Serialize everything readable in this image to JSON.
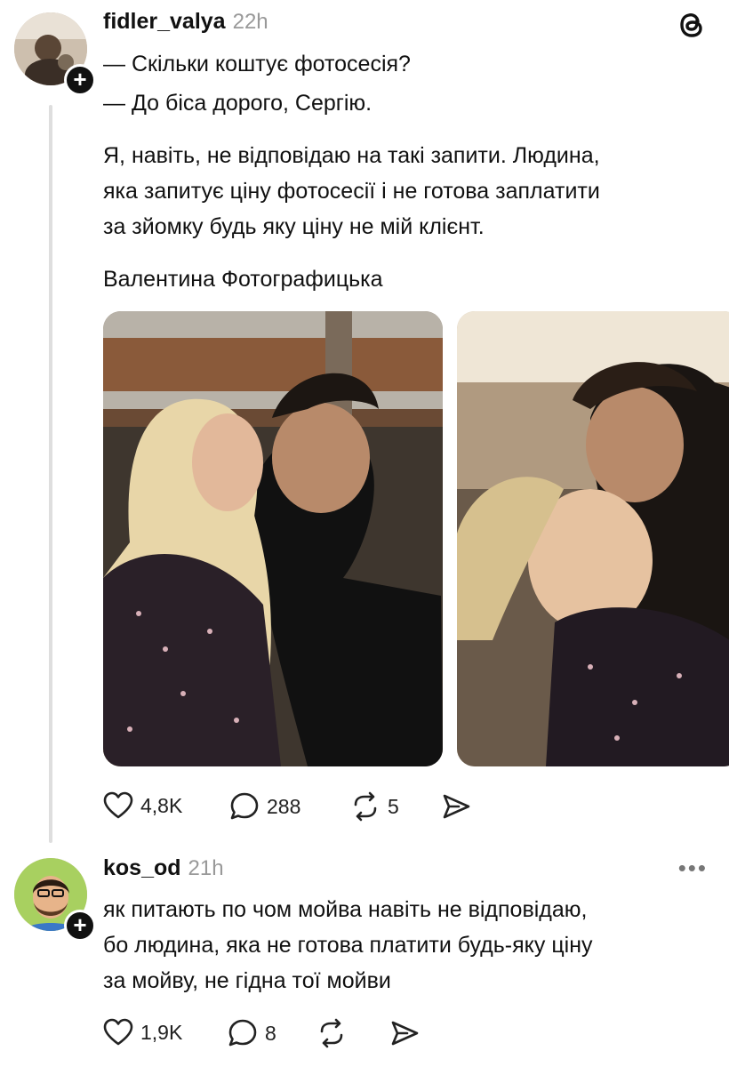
{
  "post1": {
    "username": "fidler_valya",
    "time": "22h",
    "lines": [
      "— Скільки коштує фотосесія?",
      "— До біса дорого, Сергію.",
      "Я, навіть, не відповідаю на такі запити. Людина,",
      "яка запитує ціну фотосесії і не готова заплатити",
      "за зйомку будь яку ціну не мій клієнт.",
      "Валентина Фотографицька"
    ],
    "likes": "4,8K",
    "comments": "288",
    "reposts": "5",
    "images": [
      "couple-kiss-photo-1",
      "couple-kiss-photo-2"
    ]
  },
  "post2": {
    "username": "kos_od",
    "time": "21h",
    "lines": [
      "як питають по чом мойва навіть не відповідаю,",
      "бо людина, яка не готова платити будь-яку ціну",
      "за мойву, не гідна тої мойви"
    ],
    "likes": "1,9K",
    "comments": "8",
    "more_icon": "more-dots-icon"
  },
  "app_icon": "threads-logo-icon",
  "colors": {
    "text": "#111111",
    "muted": "#999999",
    "line": "#dedede"
  }
}
